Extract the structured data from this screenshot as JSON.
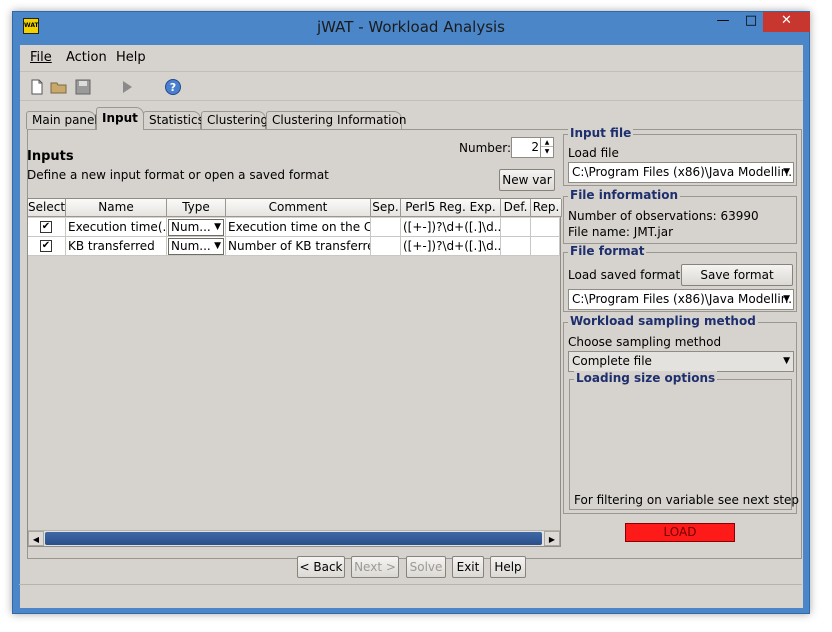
{
  "window": {
    "title": "jWAT - Workload Analysis",
    "icon_text": "WAT"
  },
  "menu": [
    {
      "label": "File",
      "mnemonic": "F"
    },
    {
      "label": "Action",
      "mnemonic": "A"
    },
    {
      "label": "Help",
      "mnemonic": "H"
    }
  ],
  "toolbar": {
    "icons": [
      "new-file-icon",
      "open-folder-icon",
      "save-icon",
      "run-icon",
      "help-icon"
    ]
  },
  "tabs": [
    {
      "label": "Main panel"
    },
    {
      "label": "Input",
      "active": true
    },
    {
      "label": "Statistics"
    },
    {
      "label": "Clustering"
    },
    {
      "label": "Clustering Information"
    }
  ],
  "inputs": {
    "title": "Inputs",
    "description": "Define a new input format or open a saved format",
    "number_label": "Number:",
    "number_value": "2",
    "new_var_label": "New var"
  },
  "table": {
    "headers": [
      "Select",
      "Name",
      "Type",
      "Comment",
      "Sep.",
      "Perl5 Reg. Exp.",
      "Def.",
      "Rep."
    ],
    "rows": [
      {
        "selected": true,
        "name": "Execution time(...",
        "type": "Num...",
        "comment": "Execution time on the CPU",
        "sep": "",
        "regex": "([+-])?\\d+([.]\\d..",
        "def": "",
        "rep": ""
      },
      {
        "selected": true,
        "name": "KB transferred",
        "type": "Num...",
        "comment": "Number of KB transferre...",
        "sep": "",
        "regex": "([+-])?\\d+([.]\\d..",
        "def": "",
        "rep": ""
      }
    ]
  },
  "input_file": {
    "title": "Input file",
    "load_label": "Load file",
    "path": "C:\\Program Files (x86)\\Java Modellin..."
  },
  "file_information": {
    "title": "File information",
    "observations": "Number of observations: 63990",
    "file_name": "File name: JMT.jar"
  },
  "file_format": {
    "title": "File format",
    "load_saved_label": "Load saved format",
    "save_button": "Save format",
    "path": "C:\\Program Files (x86)\\Java Modellin..."
  },
  "sampling": {
    "title": "Workload sampling method",
    "choose_label": "Choose sampling method",
    "selected": "Complete file",
    "loading_title": "Loading size options",
    "filter_note": "For filtering on variable see next step"
  },
  "load_button": "LOAD",
  "bottom_buttons": [
    {
      "label": "< Back",
      "enabled": true
    },
    {
      "label": "Next >",
      "enabled": false
    },
    {
      "label": "Solve",
      "enabled": false
    },
    {
      "label": "Exit",
      "enabled": true
    },
    {
      "label": "Help",
      "enabled": true
    }
  ],
  "colors": {
    "title_bar": "#4a86c8",
    "close_button": "#c7372f",
    "load_button": "#ff1a1a",
    "group_title": "#1e2f6e",
    "scroll_thumb": "#2a4f8a"
  }
}
